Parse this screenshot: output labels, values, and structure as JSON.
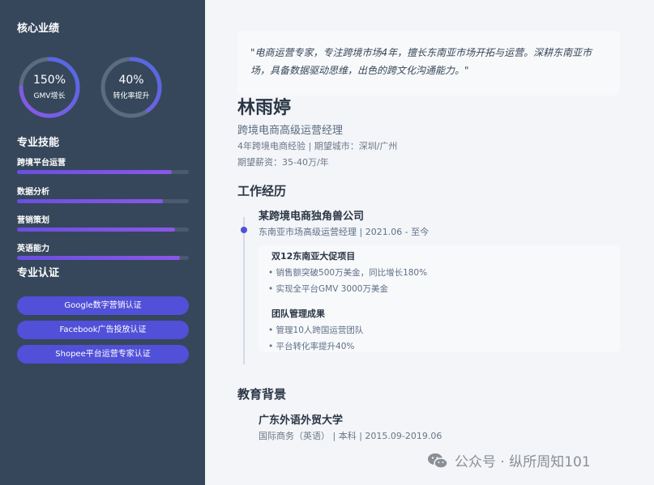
{
  "sidebar": {
    "core_title": "核心业绩",
    "metrics": [
      {
        "value": "150%",
        "label": "GMV增长",
        "progress": 0.75
      },
      {
        "value": "40%",
        "label": "转化率提升",
        "progress": 0.4
      }
    ],
    "skills_title": "专业技能",
    "skills": [
      {
        "label": "跨境平台运营",
        "level": 0.9
      },
      {
        "label": "数据分析",
        "level": 0.85
      },
      {
        "label": "营销策划",
        "level": 0.92
      },
      {
        "label": "英语能力",
        "level": 0.95
      }
    ],
    "certs_title": "专业认证",
    "certs": [
      "Google数字营销认证",
      "Facebook广告投放认证",
      "Shopee平台运营专家认证"
    ]
  },
  "colors": {
    "sidebar_bg": "#36475b",
    "accent": "#5050d8",
    "ring_track": "#5c6b7e",
    "ring_gradient_start": "#8b57e8",
    "ring_gradient_end": "#4f6be0"
  },
  "profile": {
    "quote": "\"电商运营专家，专注跨境市场4年，擅长东南亚市场开拓与运营。深耕东南亚市场，具备数据驱动思维，出色的跨文化沟通能力。\"",
    "name": "林雨婷",
    "title": "跨境电商高级运营经理",
    "experience_city": "4年跨境电商经验 | 期望城市：深圳/广州",
    "salary": "期望薪资：35-40万/年"
  },
  "work": {
    "section_title": "工作经历",
    "company": "某跨境电商独角兽公司",
    "meta": "东南亚市场高级运营经理 | 2021.06 - 至今",
    "projects": [
      {
        "title": "双12东南亚大促项目",
        "items": [
          "• 销售额突破500万美金，同比增长180%",
          "• 实现全平台GMV 3000万美金"
        ]
      },
      {
        "title": "团队管理成果",
        "items": [
          "• 管理10人跨国运营团队",
          "• 平台转化率提升40%"
        ]
      }
    ]
  },
  "education": {
    "section_title": "教育背景",
    "school": "广东外语外贸大学",
    "meta": "国际商务（英语） | 本科 | 2015.09-2019.06"
  },
  "watermark": {
    "icon": "wechat-icon",
    "text": "公众号 · 纵所周知101"
  }
}
